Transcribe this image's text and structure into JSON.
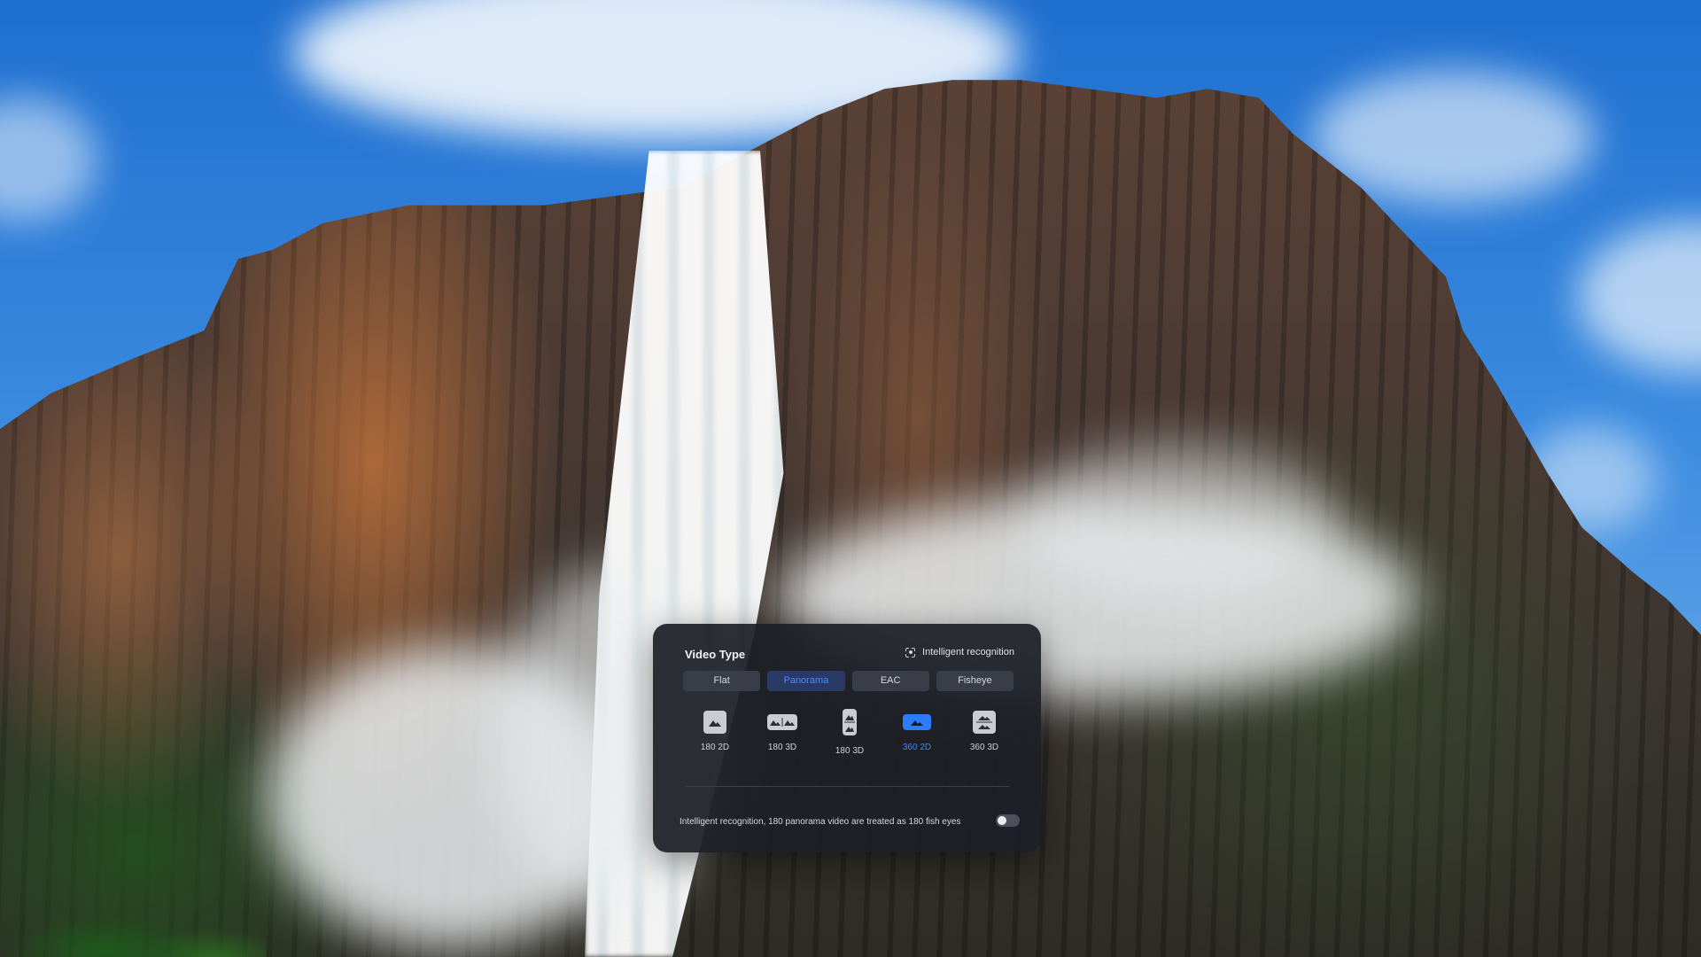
{
  "dialog": {
    "title": "Video Type",
    "intelligent_recognition_label": "Intelligent recognition",
    "tabs": [
      {
        "label": "Flat",
        "active": false
      },
      {
        "label": "Panorama",
        "active": true
      },
      {
        "label": "EAC",
        "active": false
      },
      {
        "label": "Fisheye",
        "active": false
      }
    ],
    "modes": [
      {
        "label": "180 2D",
        "icon": "image-icon",
        "active": false
      },
      {
        "label": "180 3D",
        "icon": "side-by-side-icon",
        "active": false
      },
      {
        "label": "180 3D",
        "icon": "top-bottom-icon",
        "active": false
      },
      {
        "label": "360 2D",
        "icon": "panorama-icon",
        "active": true
      },
      {
        "label": "360 3D",
        "icon": "top-bottom-panorama-icon",
        "active": false
      }
    ],
    "note": "Intelligent recognition, 180 panorama video are treated as 180 fish eyes",
    "toggle_on": false
  },
  "colors": {
    "accent": "#2d7bff",
    "dialog_bg": "#1c1f26",
    "active_tab_text": "#4b8bff"
  }
}
